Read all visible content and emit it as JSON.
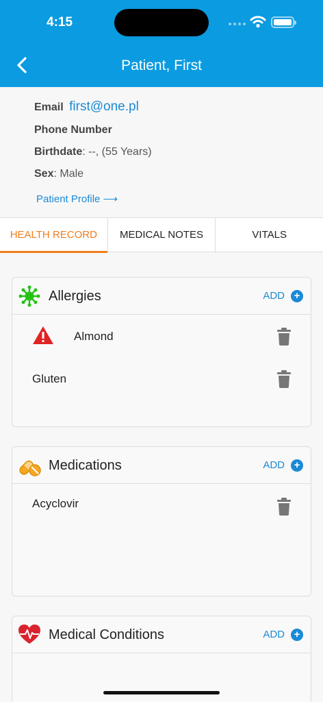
{
  "status_bar": {
    "time": "4:15"
  },
  "nav": {
    "title": "Patient, First"
  },
  "patient": {
    "email_label": "Email",
    "email_value": "first@one.pl",
    "phone_label": "Phone Number",
    "birthdate_label": "Birthdate",
    "birthdate_value": ": --, (55 Years)",
    "sex_label": "Sex",
    "sex_value": ": Male",
    "profile_link": "Patient Profile ⟶"
  },
  "tabs": [
    {
      "label": "HEALTH RECORD",
      "active": true
    },
    {
      "label": "MEDICAL NOTES",
      "active": false
    },
    {
      "label": "VITALS",
      "active": false
    }
  ],
  "cards": {
    "allergies": {
      "title": "Allergies",
      "add_label": "ADD",
      "icon": "virus-icon",
      "items": [
        {
          "label": "Almond",
          "severe": true
        },
        {
          "label": "Gluten",
          "severe": false
        }
      ]
    },
    "medications": {
      "title": "Medications",
      "add_label": "ADD",
      "icon": "pills-icon",
      "items": [
        {
          "label": "Acyclovir"
        }
      ]
    },
    "conditions": {
      "title": "Medical Conditions",
      "add_label": "ADD",
      "icon": "heartbeat-icon"
    }
  },
  "colors": {
    "header": "#0b9be0",
    "accent": "#1a8ad6",
    "active_tab": "#f07d1c",
    "allergy_icon": "#22c311",
    "warning": "#e02424",
    "medication_icon": "#f5a623",
    "heart_icon": "#d9232e"
  }
}
